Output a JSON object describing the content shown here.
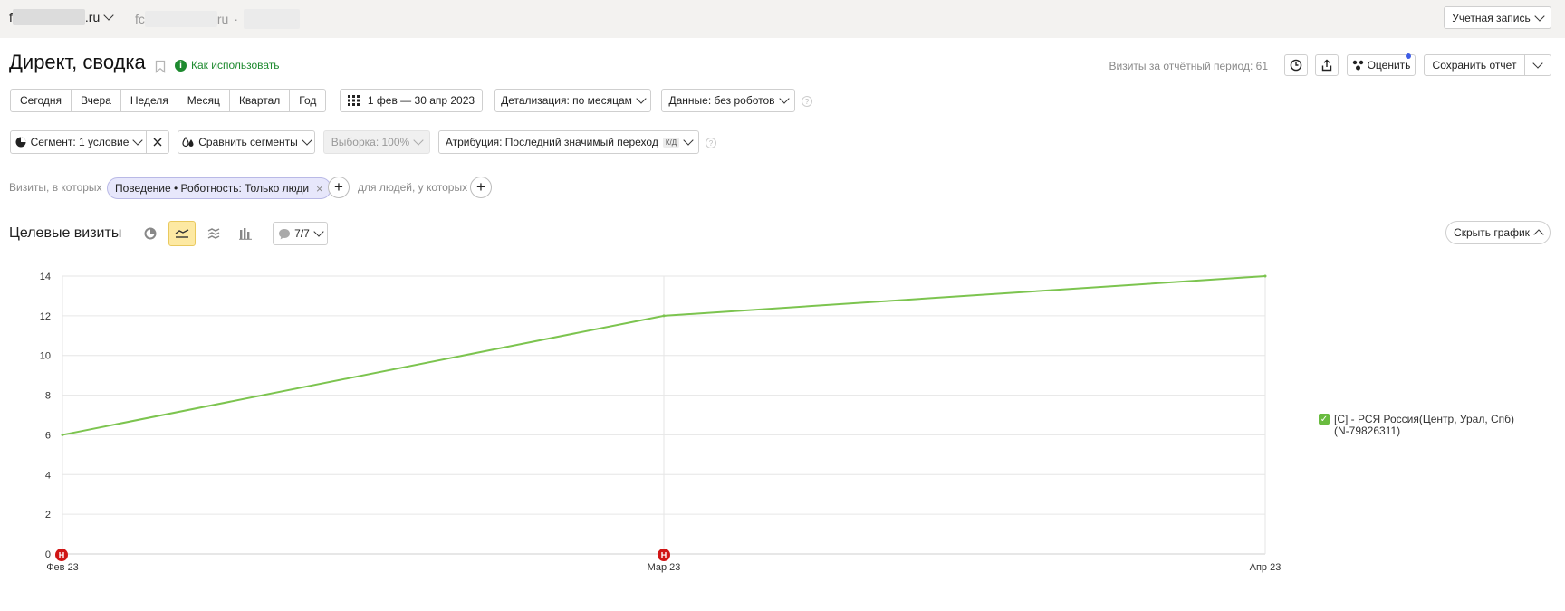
{
  "topbar": {
    "site1_prefix": "f",
    "site1_suffix": ".ru",
    "site2_prefix": "fc",
    "site2_suffix": "ru",
    "site2_sep": "·",
    "account_label": "Учетная запись"
  },
  "header": {
    "title": "Директ, сводка",
    "howto_label": "Как использовать",
    "visits_period": "Визиты за отчётный период: 61",
    "rate_label": "Оценить",
    "save_report_label": "Сохранить отчет"
  },
  "periods": [
    "Сегодня",
    "Вчера",
    "Неделя",
    "Месяц",
    "Квартал",
    "Год"
  ],
  "date_range": "1 фев — 30 апр 2023",
  "detail_label": "Детализация: по месяцам",
  "data_label": "Данные: без роботов",
  "segment_label": "Сегмент: 1 условие",
  "compare_label": "Сравнить сегменты",
  "sample_label": "Выборка: 100%",
  "attribution_label": "Атрибуция: Последний значимый переход",
  "attribution_badge": "К/Д",
  "filter": {
    "visits_prefix": "Визиты, в которых",
    "chip_label": "Поведение • Роботность: Только люди",
    "people_label": "для людей, у которых"
  },
  "chart_section": {
    "title": "Целевые визиты",
    "annotations_label": "7/7",
    "hide_chart_label": "Скрыть график"
  },
  "colors": {
    "line": "#7cc44f",
    "marker": "#d01515",
    "checkbox": "#69bb3f"
  },
  "chart_data": {
    "type": "line",
    "x": [
      "Фев 23",
      "Мар 23",
      "Апр 23"
    ],
    "series": [
      {
        "name": "[С] - РСЯ Россия(Центр, Урал, Спб) (N-79826311)",
        "values": [
          6,
          12,
          14
        ]
      }
    ],
    "ylim": [
      0,
      14
    ],
    "yticks": [
      0,
      2,
      4,
      6,
      8,
      10,
      12,
      14
    ],
    "grid": true,
    "legend": "right",
    "markers": [
      {
        "x": "Фев 23",
        "label": "Н"
      },
      {
        "x": "Мар 23",
        "label": "Н"
      }
    ]
  }
}
